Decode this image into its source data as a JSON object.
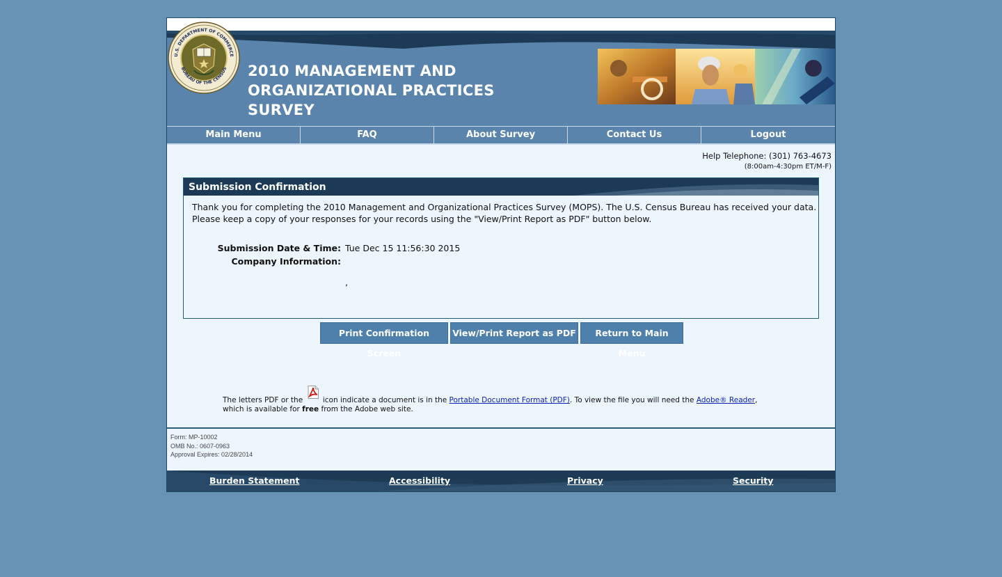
{
  "header": {
    "title_lines": [
      "2010 MANAGEMENT AND",
      "ORGANIZATIONAL PRACTICES",
      "SURVEY"
    ],
    "seal_text_top": "U.S. DEPARTMENT OF COMMERCE",
    "seal_text_bottom": "BUREAU OF THE CENSUS",
    "seal_icon": "census-bureau-seal-icon",
    "photo": "workers-photo-banner"
  },
  "nav": {
    "items": [
      "Main Menu",
      "FAQ",
      "About Survey",
      "Contact Us",
      "Logout"
    ]
  },
  "help": {
    "phone": "Help Telephone: (301) 763-4673",
    "hours": "(8:00am-4:30pm ET/M-F)"
  },
  "confirmation": {
    "title": "Submission Confirmation",
    "message_line1": "Thank you for completing the 2010 Management and Organizational Practices Survey (MOPS). The U.S. Census Bureau has received your data.",
    "message_line2": "Please keep a copy of your responses for your records using the \"View/Print Report as PDF\" button below.",
    "date_label": "Submission Date & Time:",
    "date_value": "Tue Dec 15 11:56:30 2015",
    "company_label": "Company Information:",
    "company_value": ","
  },
  "buttons": {
    "print": "Print Confirmation Screen",
    "pdf": "View/Print Report as PDF",
    "main": "Return to Main Menu"
  },
  "pdf_note": {
    "part1": "The letters PDF or the",
    "part2": "icon indicate a document is in the",
    "link1": "Portable Document Format (PDF)",
    "part3": ". To view the file you will need the",
    "link2": "Adobe® Reader",
    "part4": ", which is available for",
    "bold": "free",
    "part5": "from the Adobe web site.",
    "icon": "pdf-icon"
  },
  "form_meta": {
    "form": "Form: MP-10002",
    "omb": "OMB No.: 0607-0963",
    "expires": "Approval Expires: 02/28/2014"
  },
  "footer": {
    "links": [
      "Burden Statement",
      "Accessibility",
      "Privacy",
      "Security"
    ]
  },
  "colors": {
    "background": "#6893b4",
    "header_blue": "#5a84ab",
    "dark_navy": "#1c3a55",
    "button_blue": "#4f7fab",
    "content_bg": "#eef6fd"
  }
}
